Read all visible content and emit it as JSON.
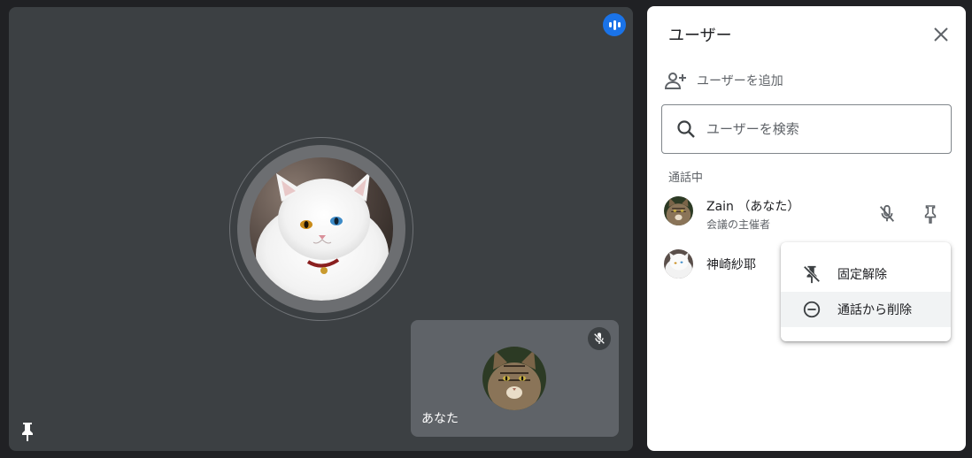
{
  "panel": {
    "title": "ユーザー",
    "add_user_label": "ユーザーを追加",
    "search_placeholder": "ユーザーを検索",
    "section_label": "通話中"
  },
  "participants": [
    {
      "name": "Zain （あなた）",
      "role": "会議の主催者",
      "avatar": "tabby-cat",
      "muted": true,
      "pinned": true
    },
    {
      "name": "神崎紗耶",
      "avatar": "white-persian-cat"
    }
  ],
  "context_menu": {
    "items": [
      {
        "label": "固定解除",
        "icon": "unpin-icon"
      },
      {
        "label": "通話から削除",
        "icon": "remove-circle-icon"
      }
    ]
  },
  "self_tile": {
    "label": "あなた",
    "muted": true
  },
  "colors": {
    "stage": "#202124",
    "tile": "#3c4043",
    "accent": "#1a73e8"
  }
}
